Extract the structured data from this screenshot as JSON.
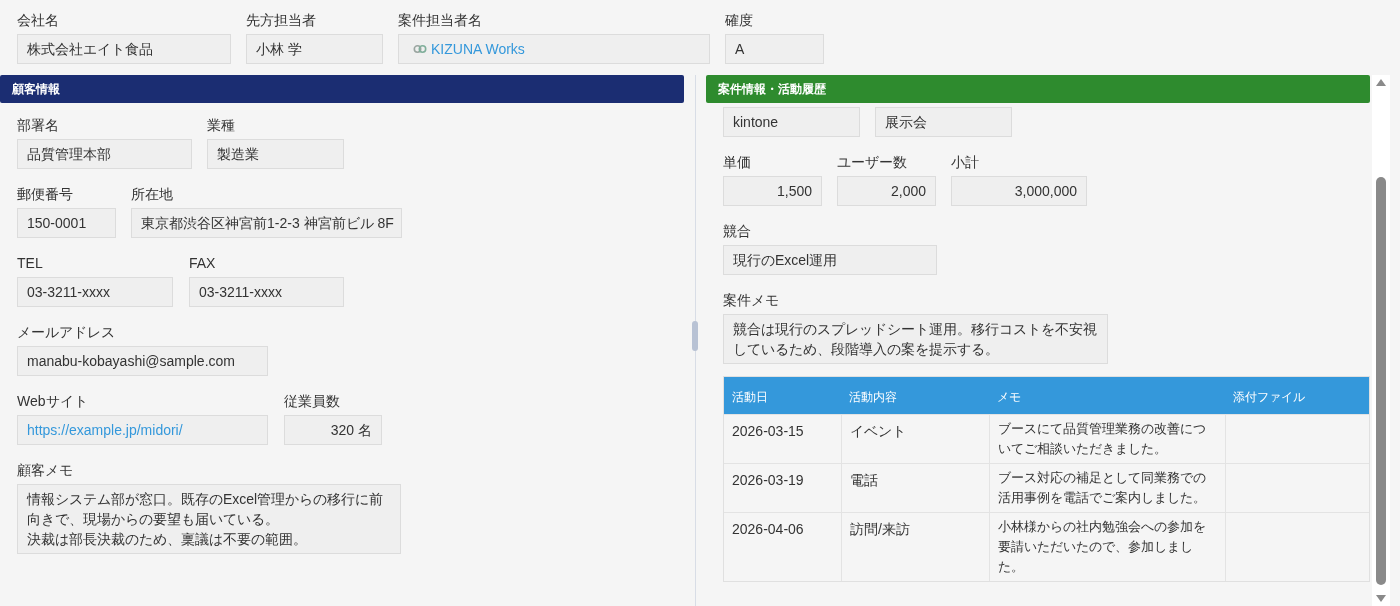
{
  "header_fields": [
    {
      "label": "会社名",
      "value": "株式会社エイト食品",
      "kind": "text"
    },
    {
      "label": "先方担当者",
      "value": "小林 学",
      "kind": "text"
    },
    {
      "label": "案件担当者名",
      "value": "KIZUNA Works",
      "kind": "user"
    },
    {
      "label": "確度",
      "value": "A",
      "kind": "text"
    }
  ],
  "customer_section": {
    "title": "顧客情報",
    "rows": [
      [
        {
          "label": "部署名",
          "value": "品質管理本部",
          "kind": "text"
        },
        {
          "label": "業種",
          "value": "製造業",
          "kind": "text"
        }
      ],
      [
        {
          "label": "郵便番号",
          "value": "150-0001",
          "kind": "text"
        },
        {
          "label": "所在地",
          "value": "東京都渋谷区神宮前1-2-3 神宮前ビル 8F",
          "kind": "text"
        }
      ],
      [
        {
          "label": "TEL",
          "value": "03-3211-xxxx",
          "kind": "text"
        },
        {
          "label": "FAX",
          "value": "03-3211-xxxx",
          "kind": "text"
        }
      ],
      [
        {
          "label": "メールアドレス",
          "value": "manabu-kobayashi@sample.com",
          "kind": "text"
        }
      ],
      [
        {
          "label": "Webサイト",
          "value": "https://example.jp/midori/",
          "kind": "link"
        },
        {
          "label": "従業員数",
          "value": "320 名",
          "kind": "number"
        }
      ],
      [
        {
          "label": "顧客メモ",
          "lines": [
            "情報システム部が窓口。既存のExcel管理からの移行に前向きで、現場からの要望も届いている。",
            "決裁は部長決裁のため、稟議は不要の範囲。"
          ],
          "kind": "memo"
        }
      ]
    ]
  },
  "deal_section": {
    "title": "案件情報・活動履歴",
    "rows": [
      [
        {
          "value": "kintone",
          "kind": "text"
        },
        {
          "value": "展示会",
          "kind": "text"
        }
      ],
      [
        {
          "label": "単価",
          "value": "1,500",
          "kind": "number"
        },
        {
          "label": "ユーザー数",
          "value": "2,000",
          "kind": "number"
        },
        {
          "label": "小計",
          "value": "3,000,000",
          "kind": "number"
        }
      ],
      [
        {
          "label": "競合",
          "value": "現行のExcel運用",
          "kind": "text"
        }
      ],
      [
        {
          "label": "案件メモ",
          "lines": [
            "競合は現行のスプレッドシート運用。移行コストを不安視しているため、段階導入の案を提示する。"
          ],
          "kind": "memo"
        }
      ]
    ],
    "activity_table": {
      "columns": [
        "活動日",
        "活動内容",
        "メモ",
        "添付ファイル"
      ],
      "rows": [
        {
          "date": "2026-03-15",
          "activity": "イベント",
          "memo": "ブースにて品質管理業務の改善についてご相談いただきました。"
        },
        {
          "date": "2026-03-19",
          "activity": "電話",
          "memo": "ブース対応の補足として同業務での活用事例を電話でご案内しました。"
        },
        {
          "date": "2026-04-06",
          "activity": "訪問/来訪",
          "memo": "小林様からの社内勉強会への参加を要請いただいたので、参加しました。"
        }
      ]
    }
  }
}
